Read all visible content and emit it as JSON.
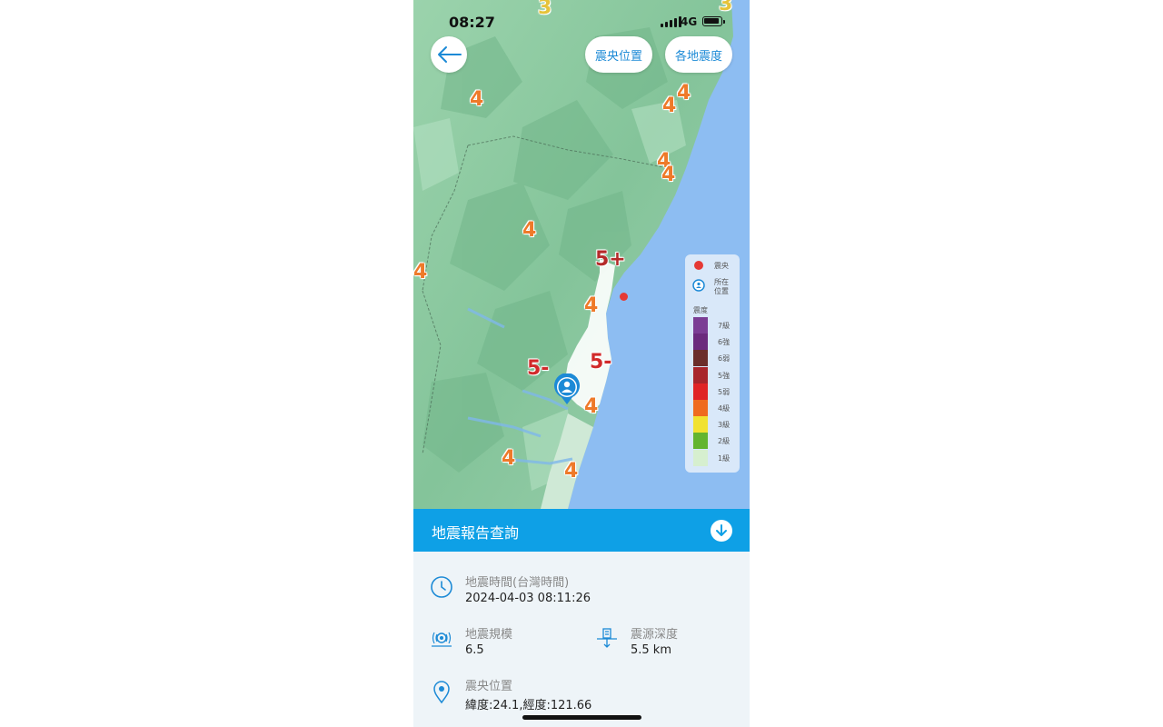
{
  "status_bar": {
    "time": "08:27",
    "network": "4G"
  },
  "map": {
    "buttons": {
      "epicenter_location": "震央位置",
      "regional_intensity": "各地震度"
    },
    "intensity_labels": [
      {
        "label": "3",
        "color": "#e5c33a"
      },
      {
        "label": "3",
        "color": "#e5c33a"
      },
      {
        "label": "4",
        "color": "#ee7a2a"
      },
      {
        "label": "4",
        "color": "#ee7a2a"
      },
      {
        "label": "4",
        "color": "#ee7a2a"
      },
      {
        "label": "4",
        "color": "#ee7a2a"
      },
      {
        "label": "4",
        "color": "#ee7a2a"
      },
      {
        "label": "4",
        "color": "#ee7a2a"
      },
      {
        "label": "4",
        "color": "#ee7a2a"
      },
      {
        "label": "5+",
        "color": "#b52a2a"
      },
      {
        "label": "4",
        "color": "#ee7a2a"
      },
      {
        "label": "5-",
        "color": "#d12a2a"
      },
      {
        "label": "5-",
        "color": "#d12a2a"
      },
      {
        "label": "4",
        "color": "#ee7a2a"
      },
      {
        "label": "4",
        "color": "#ee7a2a"
      },
      {
        "label": "4",
        "color": "#ee7a2a"
      }
    ],
    "legend": {
      "epicenter": "震央",
      "location_line1": "所在",
      "location_line2": "位置",
      "intensity_title": "震度",
      "levels": [
        {
          "label": "7級",
          "color": "#7b3d94"
        },
        {
          "label": "6強",
          "color": "#6b2a7d"
        },
        {
          "label": "6弱",
          "color": "#6b2e2a"
        },
        {
          "label": "5強",
          "color": "#a8262b"
        },
        {
          "label": "5弱",
          "color": "#e02425"
        },
        {
          "label": "4級",
          "color": "#ef6b1e"
        },
        {
          "label": "3級",
          "color": "#f1e230"
        },
        {
          "label": "2級",
          "color": "#63b52f"
        },
        {
          "label": "1級",
          "color": "#d6efcf"
        }
      ]
    }
  },
  "report": {
    "title": "地震報告查詢",
    "time_label": "地震時間(台灣時間)",
    "time_value": "2024-04-03 08:11:26",
    "magnitude_label": "地震規模",
    "magnitude_value": "6.5",
    "depth_label": "震源深度",
    "depth_value": "5.5 km",
    "epicenter_label": "震央位置",
    "epicenter_value": "緯度:24.1,經度:121.66"
  },
  "colors": {
    "accent": "#0ea0e6",
    "sea": "#8dbdf2",
    "land": "#8fcaa3"
  }
}
